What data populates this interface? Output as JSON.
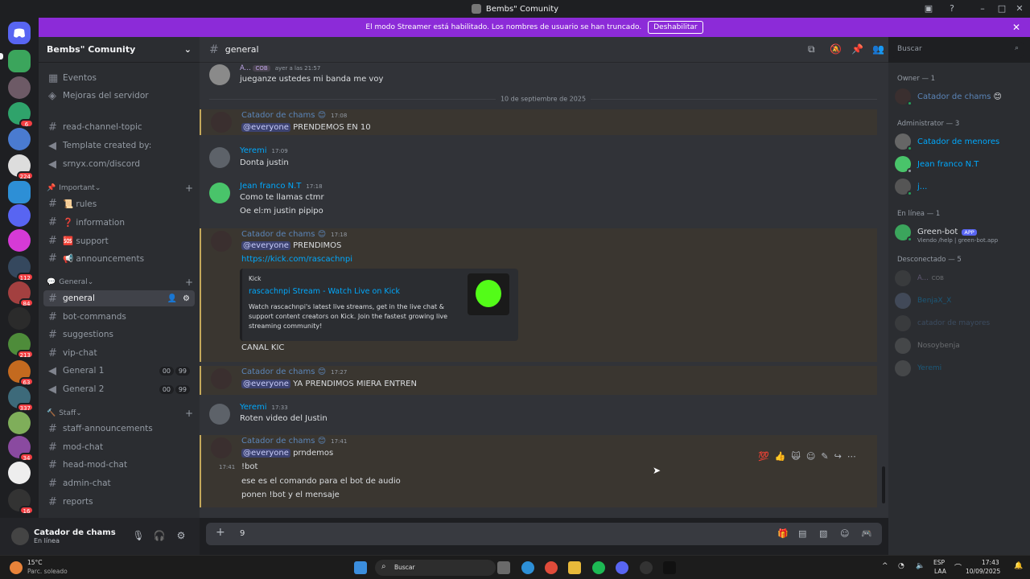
{
  "window": {
    "title": "Bembs\" Comunity"
  },
  "banner": {
    "text": "El modo Streamer está habilitado. Los nombres de usuario se han truncado.",
    "button": "Deshabilitar"
  },
  "rail": {
    "badges": [
      "6",
      "224",
      "112",
      "84",
      "213",
      "63",
      "337",
      "34",
      "16"
    ]
  },
  "sidebar": {
    "server_name": "Bembs\" Comunity",
    "top_items": [
      "Eventos",
      "Mejoras del servidor"
    ],
    "channels_top": [
      "read-channel-topic",
      "Template created by:",
      "srnyx.com/discord"
    ],
    "cat_important": "Important",
    "important": [
      "📜 rules",
      "❓ information",
      "🆘 support",
      "📢 announcements"
    ],
    "cat_general": "General",
    "general": [
      "general",
      "bot-commands",
      "suggestions",
      "vip-chat",
      "General 1",
      "General 2"
    ],
    "vc_counts": [
      "00",
      "99",
      "00",
      "99"
    ],
    "cat_staff": "Staff",
    "staff": [
      "staff-announcements",
      "mod-chat",
      "head-mod-chat",
      "admin-chat",
      "reports"
    ]
  },
  "user_panel": {
    "name": "Catador de chams",
    "status": "En línea"
  },
  "chat": {
    "channel": "general",
    "search_placeholder": "Buscar",
    "date_divider": "10 de septiembre de 2025",
    "messages": [
      {
        "author": "A...",
        "tag": "COB",
        "time": "ayer a las 21:57",
        "lines": [
          "jueganze ustedes mi banda me voy"
        ]
      },
      {
        "author": "Catador de chams",
        "time": "17:08",
        "mention": "@everyone",
        "lines": [
          "PRENDEMOS EN 10"
        ]
      },
      {
        "author": "Yeremi",
        "time": "17:09",
        "lines": [
          "Donta justin"
        ]
      },
      {
        "author": "Jean franco N.T",
        "time": "17:18",
        "lines": [
          "Como te llamas ctmr",
          "Oe el:m justin pipipo"
        ]
      },
      {
        "author": "Catador de chams",
        "time": "17:18",
        "mention": "@everyone",
        "lines": [
          "PRENDIMOS",
          "https://kick.com/rascachnpi",
          "CANAL KIC"
        ]
      },
      {
        "author": "Catador de chams",
        "time": "17:27",
        "mention": "@everyone",
        "lines": [
          "YA PRENDIMOS MIERA ENTREN"
        ]
      },
      {
        "author": "Yeremi",
        "time": "17:33",
        "lines": [
          "Roten video del Justin"
        ]
      },
      {
        "author": "Catador de chams",
        "time": "17:41",
        "mention": "@everyone",
        "lines": [
          "prndemos",
          "!bot",
          "ese es el comando para el bot de audio",
          "ponen !bot y el mensaje"
        ],
        "side_time": "17:41"
      }
    ],
    "embed": {
      "provider": "Kick",
      "title": "rascachnpi Stream - Watch Live on Kick",
      "description_lines": [
        "Watch rascachnpi's latest live streams, get in the live chat &",
        "support content creators on Kick. Join the fastest growing live",
        "streaming community!"
      ]
    },
    "composer_value": "9"
  },
  "members": {
    "groups": [
      {
        "title": "Owner — 1",
        "members": [
          "Catador de chams"
        ]
      },
      {
        "title": "Administrator — 3",
        "members": [
          "Catador de menores",
          "Jean franco N.T",
          "j..."
        ]
      },
      {
        "title": "En línea — 1",
        "members": [
          "Green-bot"
        ]
      },
      {
        "title": "Desconectado — 5",
        "members": [
          "A...",
          "BenjaX_X",
          "catador de mayores",
          "Nosoybenja",
          "Yeremi"
        ]
      }
    ],
    "bot_tag": "APP",
    "bot_status": "Viendo /help | green-bot.app",
    "offline_tag": "COB"
  },
  "taskbar": {
    "weather_temp": "15°C",
    "weather_desc": "Parc. soleado",
    "search": "Buscar",
    "lang": "ESP",
    "lang2": "LAA",
    "time": "17:43",
    "date": "10/09/2025"
  },
  "colors": {
    "banner": "#8c2bd8",
    "accent": "#5865f2",
    "online": "#23a55a",
    "link": "#00a8fc"
  }
}
